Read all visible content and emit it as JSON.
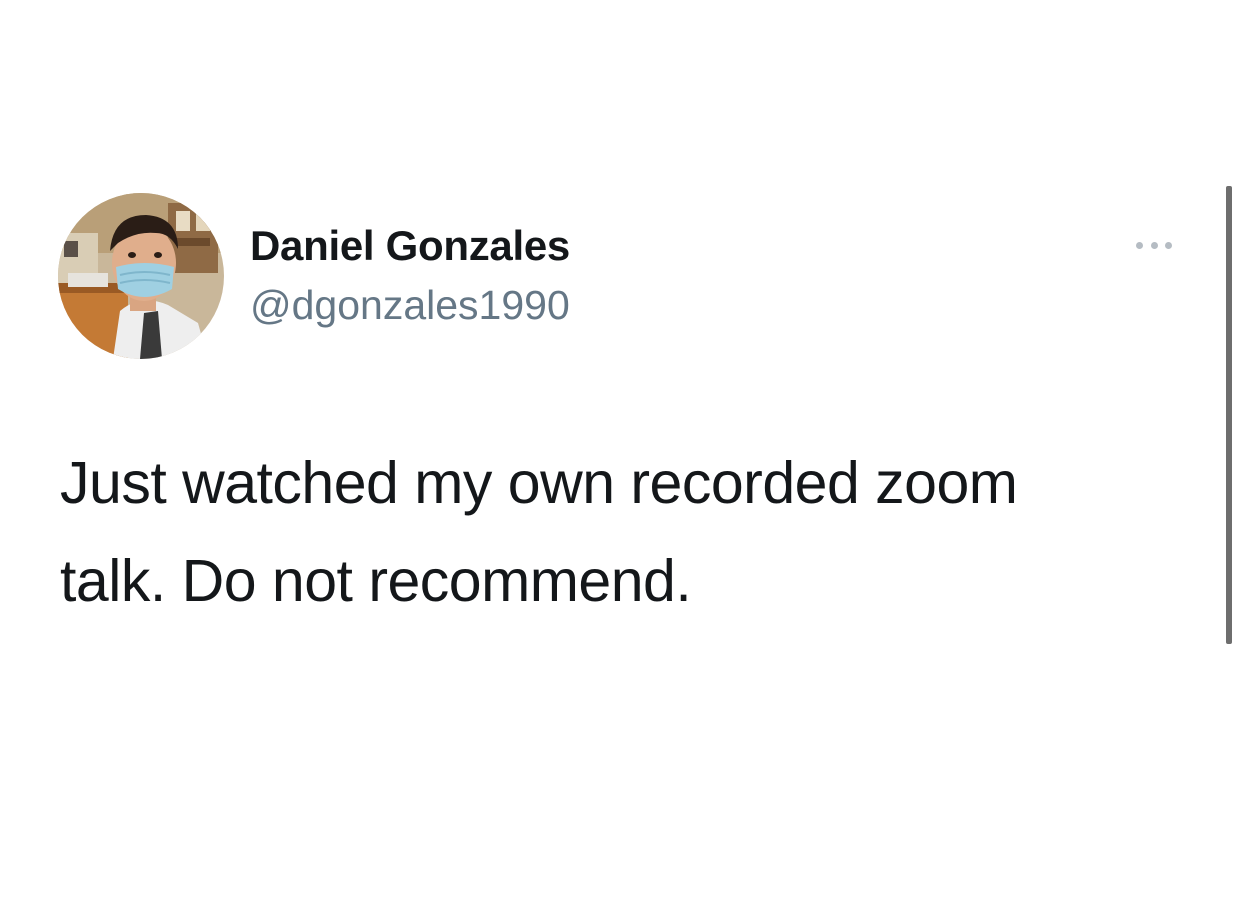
{
  "tweet": {
    "author": {
      "display_name": "Daniel Gonzales",
      "handle": "@dgonzales1990",
      "avatar": "profile-photo-masked-person-in-lab-coat"
    },
    "text_lines": [
      "Just watched my own recorded zoom",
      "talk. Do not recommend."
    ],
    "more_icon": "ellipsis-icon"
  },
  "colors": {
    "background": "#ffffff",
    "name": "#14171a",
    "handle": "#657786",
    "more_dots": "#b5bcc3",
    "scrollbar": "#6e6e6e"
  }
}
